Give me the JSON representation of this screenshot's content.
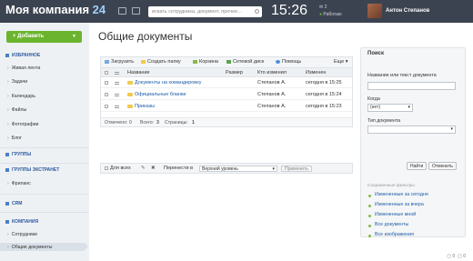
{
  "header": {
    "brand": "Моя компания",
    "brand_num": "24",
    "search_placeholder": "искать сотрудника, документ, прочее...",
    "time": "15:26",
    "notif_count": "2",
    "status": "Работаю",
    "user_name": "Антон Степанов"
  },
  "sidebar": {
    "add_button": "Добавить",
    "sections": {
      "favorites": "ИЗБРАННОЕ",
      "groups": "ГРУППЫ",
      "extranet": "ГРУППЫ ЭКСТРАНЕТ",
      "crm": "CRM",
      "company": "КОМПАНИЯ"
    },
    "favorites_items": [
      "Живая лента",
      "Задачи",
      "Календарь",
      "Файлы",
      "Фотографии",
      "Блог"
    ],
    "extranet_items": [
      "Фриланс"
    ],
    "company_items": [
      "Сотрудники",
      "Общие документы"
    ]
  },
  "main": {
    "title": "Общие документы",
    "toolbar": {
      "upload": "Загрузить",
      "new_folder": "Создать папку",
      "trash": "Корзина",
      "network_drive": "Сетевой диск",
      "help": "Помощь",
      "more": "Еще"
    },
    "columns": [
      "Название",
      "Размер",
      "Кто изменил",
      "Изменен"
    ],
    "rows": [
      {
        "name": "Документы на командировку",
        "size": "",
        "author": "Степанов А.",
        "modified": "сегодня в 15:25"
      },
      {
        "name": "Официальные бланки",
        "size": "",
        "author": "Степанов А.",
        "modified": "сегодня в 15:24"
      },
      {
        "name": "Приказы",
        "size": "",
        "author": "Степанов А.",
        "modified": "сегодня в 15:23"
      }
    ],
    "footer": {
      "selected": "Отмечено: 0",
      "total_label": "Всего:",
      "total": "3",
      "pages_label": "Страницы:",
      "pages": "1"
    },
    "actions": {
      "for_all": "Для всех",
      "move_to": "Перенести в",
      "target": "Верхний уровень",
      "apply": "Применить"
    }
  },
  "search_panel": {
    "title": "Поиск",
    "name_label": "Название или текст документа",
    "name_value": "",
    "when_label": "Когда",
    "when_value": "(нет)",
    "type_label": "Тип документа",
    "type_value": "",
    "find_btn": "Найти",
    "cancel_btn": "Отменить",
    "saved_filters_label": "Сохраненные фильтры",
    "filters": [
      "Измененные за сегодня",
      "Измененные за вчера",
      "Измененные мной",
      "Все документы",
      "Все изображения"
    ]
  },
  "footer": {
    "count_a": "0",
    "count_b": "0"
  }
}
